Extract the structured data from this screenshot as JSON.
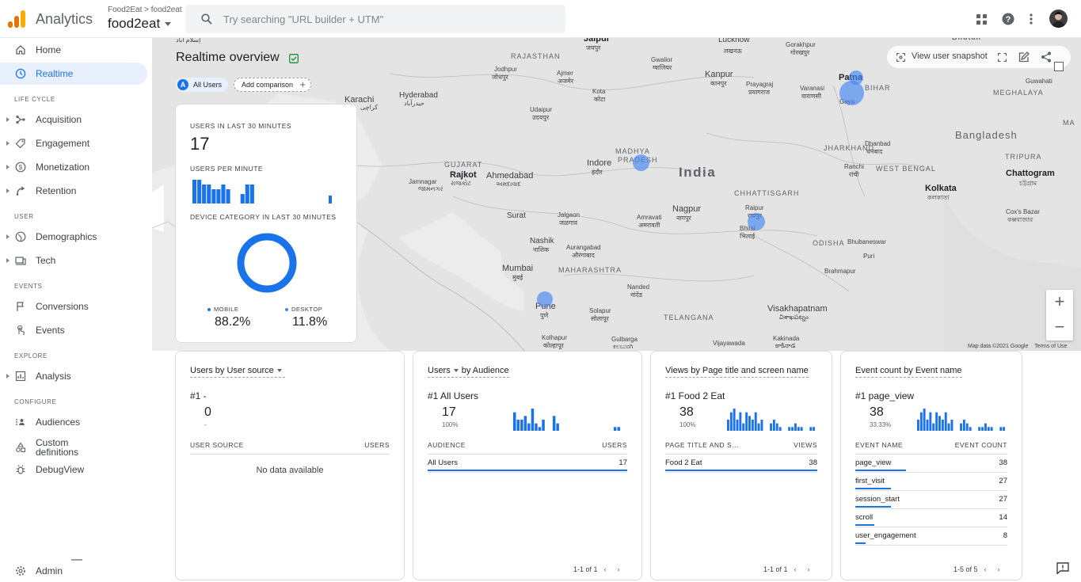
{
  "header": {
    "app_name": "Analytics",
    "account_path": "Food2Eat > food2eat",
    "property": "food2eat",
    "search_placeholder": "Try searching \"URL builder + UTM\""
  },
  "sidebar": {
    "home": "Home",
    "realtime": "Realtime",
    "sections": {
      "lifecycle": "LIFE CYCLE",
      "user": "USER",
      "events": "EVENTS",
      "explore": "EXPLORE",
      "configure": "CONFIGURE"
    },
    "lifecycle_items": [
      "Acquisition",
      "Engagement",
      "Monetization",
      "Retention"
    ],
    "user_items": [
      "Demographics",
      "Tech"
    ],
    "events_items": [
      "Conversions",
      "Events"
    ],
    "explore_items": [
      "Analysis"
    ],
    "configure_items": [
      "Audiences",
      "Custom definitions",
      "DebugView"
    ],
    "admin": "Admin"
  },
  "realtime": {
    "title": "Realtime overview",
    "chip_all_users": "All Users",
    "chip_all_users_letter": "A",
    "add_comparison": "Add comparison",
    "view_snapshot": "View user snapshot"
  },
  "map": {
    "labels": {
      "country": "India",
      "bangladesh": "Bangladesh",
      "states": [
        "RAJASTHAN",
        "GUJARAT",
        "MADHYA PRADESH",
        "MAHARASHTRA",
        "CHHATTISGARH",
        "JHARKHAND",
        "WEST BENGAL",
        "BIHAR",
        "ODISHA",
        "TELANGANA",
        "MEGHALAYA",
        "TRIPURA"
      ],
      "cities": [
        "Karachi",
        "Hyderabad",
        "Jodhpur",
        "Ajmer",
        "Gwalior",
        "Lucknow",
        "Kanpur",
        "Prayagraj",
        "Varanasi",
        "Gorakhpur",
        "Patna",
        "Gaya",
        "Guwahati",
        "Udaipur",
        "Kota",
        "Dhanbad",
        "Ranchi",
        "Rajkot",
        "Ahmedabad",
        "Indore",
        "Jamnagar",
        "Surat",
        "Jalgaon",
        "Amravati",
        "Nagpur",
        "Raipur",
        "Bhilai",
        "Kolkata",
        "Chattogram",
        "Nashik",
        "Aurangabad",
        "Mumbai",
        "Pune",
        "Nanded",
        "Solapur",
        "Kolhapur",
        "Gulbarga",
        "Visakhapatnam",
        "Vijayawada",
        "Kakinada",
        "Bhubaneswar",
        "Puri",
        "Brahmapur",
        "Cox's Bazar",
        "Jaipur"
      ]
    },
    "attribution": "Map data ©2021 Google",
    "terms": "Terms of Use"
  },
  "summary_card": {
    "users_30_label": "USERS IN LAST 30 MINUTES",
    "users_30_value": "17",
    "per_minute_label": "USERS PER MINUTE",
    "device_label": "DEVICE CATEGORY IN LAST 30 MINUTES",
    "mobile_label": "MOBILE",
    "mobile_value": "88.2%",
    "mobile_share": 0.882,
    "desktop_label": "DESKTOP",
    "desktop_value": "11.8%",
    "desktop_share": 0.118,
    "per_minute_series": [
      5,
      5,
      4,
      4,
      3,
      3,
      4,
      3,
      0,
      0,
      2,
      4,
      4,
      0,
      0,
      0,
      0,
      0,
      0,
      0,
      0,
      0,
      0,
      0,
      0,
      0,
      0,
      0,
      0,
      0
    ]
  },
  "cards": {
    "user_source": {
      "title": "Users by User source",
      "rank": "#1 -",
      "value": "0",
      "pct": "-",
      "col1": "USER SOURCE",
      "col2": "USERS",
      "empty": "No data available"
    },
    "audience": {
      "title_a": "Users",
      "title_b": "by Audience",
      "rank": "#1  All Users",
      "value": "17",
      "pct": "100%",
      "col1": "AUDIENCE",
      "col2": "USERS",
      "rows": [
        {
          "name": "All Users",
          "value": "17",
          "share": 1
        }
      ],
      "pager": "1-1 of 1"
    },
    "page_title": {
      "title": "Views by Page title and screen name",
      "rank": "#1  Food 2 Eat",
      "value": "38",
      "pct": "100%",
      "col1": "PAGE TITLE AND S…",
      "col2": "VIEWS",
      "rows": [
        {
          "name": "Food 2 Eat",
          "value": "38",
          "share": 1
        }
      ],
      "pager": "1-1 of 1"
    },
    "event_count": {
      "title": "Event count by Event name",
      "rank": "#1  page_view",
      "value": "38",
      "pct": "33.33%",
      "col1": "EVENT NAME",
      "col2": "EVENT COUNT",
      "rows": [
        {
          "name": "page_view",
          "value": "38",
          "share": 1
        },
        {
          "name": "first_visit",
          "value": "27",
          "share": 0.71
        },
        {
          "name": "session_start",
          "value": "27",
          "share": 0.71
        },
        {
          "name": "scroll",
          "value": "14",
          "share": 0.37
        },
        {
          "name": "user_engagement",
          "value": "8",
          "share": 0.21
        }
      ],
      "pager": "1-5 of 5"
    }
  },
  "colors": {
    "accent": "#1a73e8",
    "bubble": "#4285f4",
    "map": "#e4e4e4"
  }
}
